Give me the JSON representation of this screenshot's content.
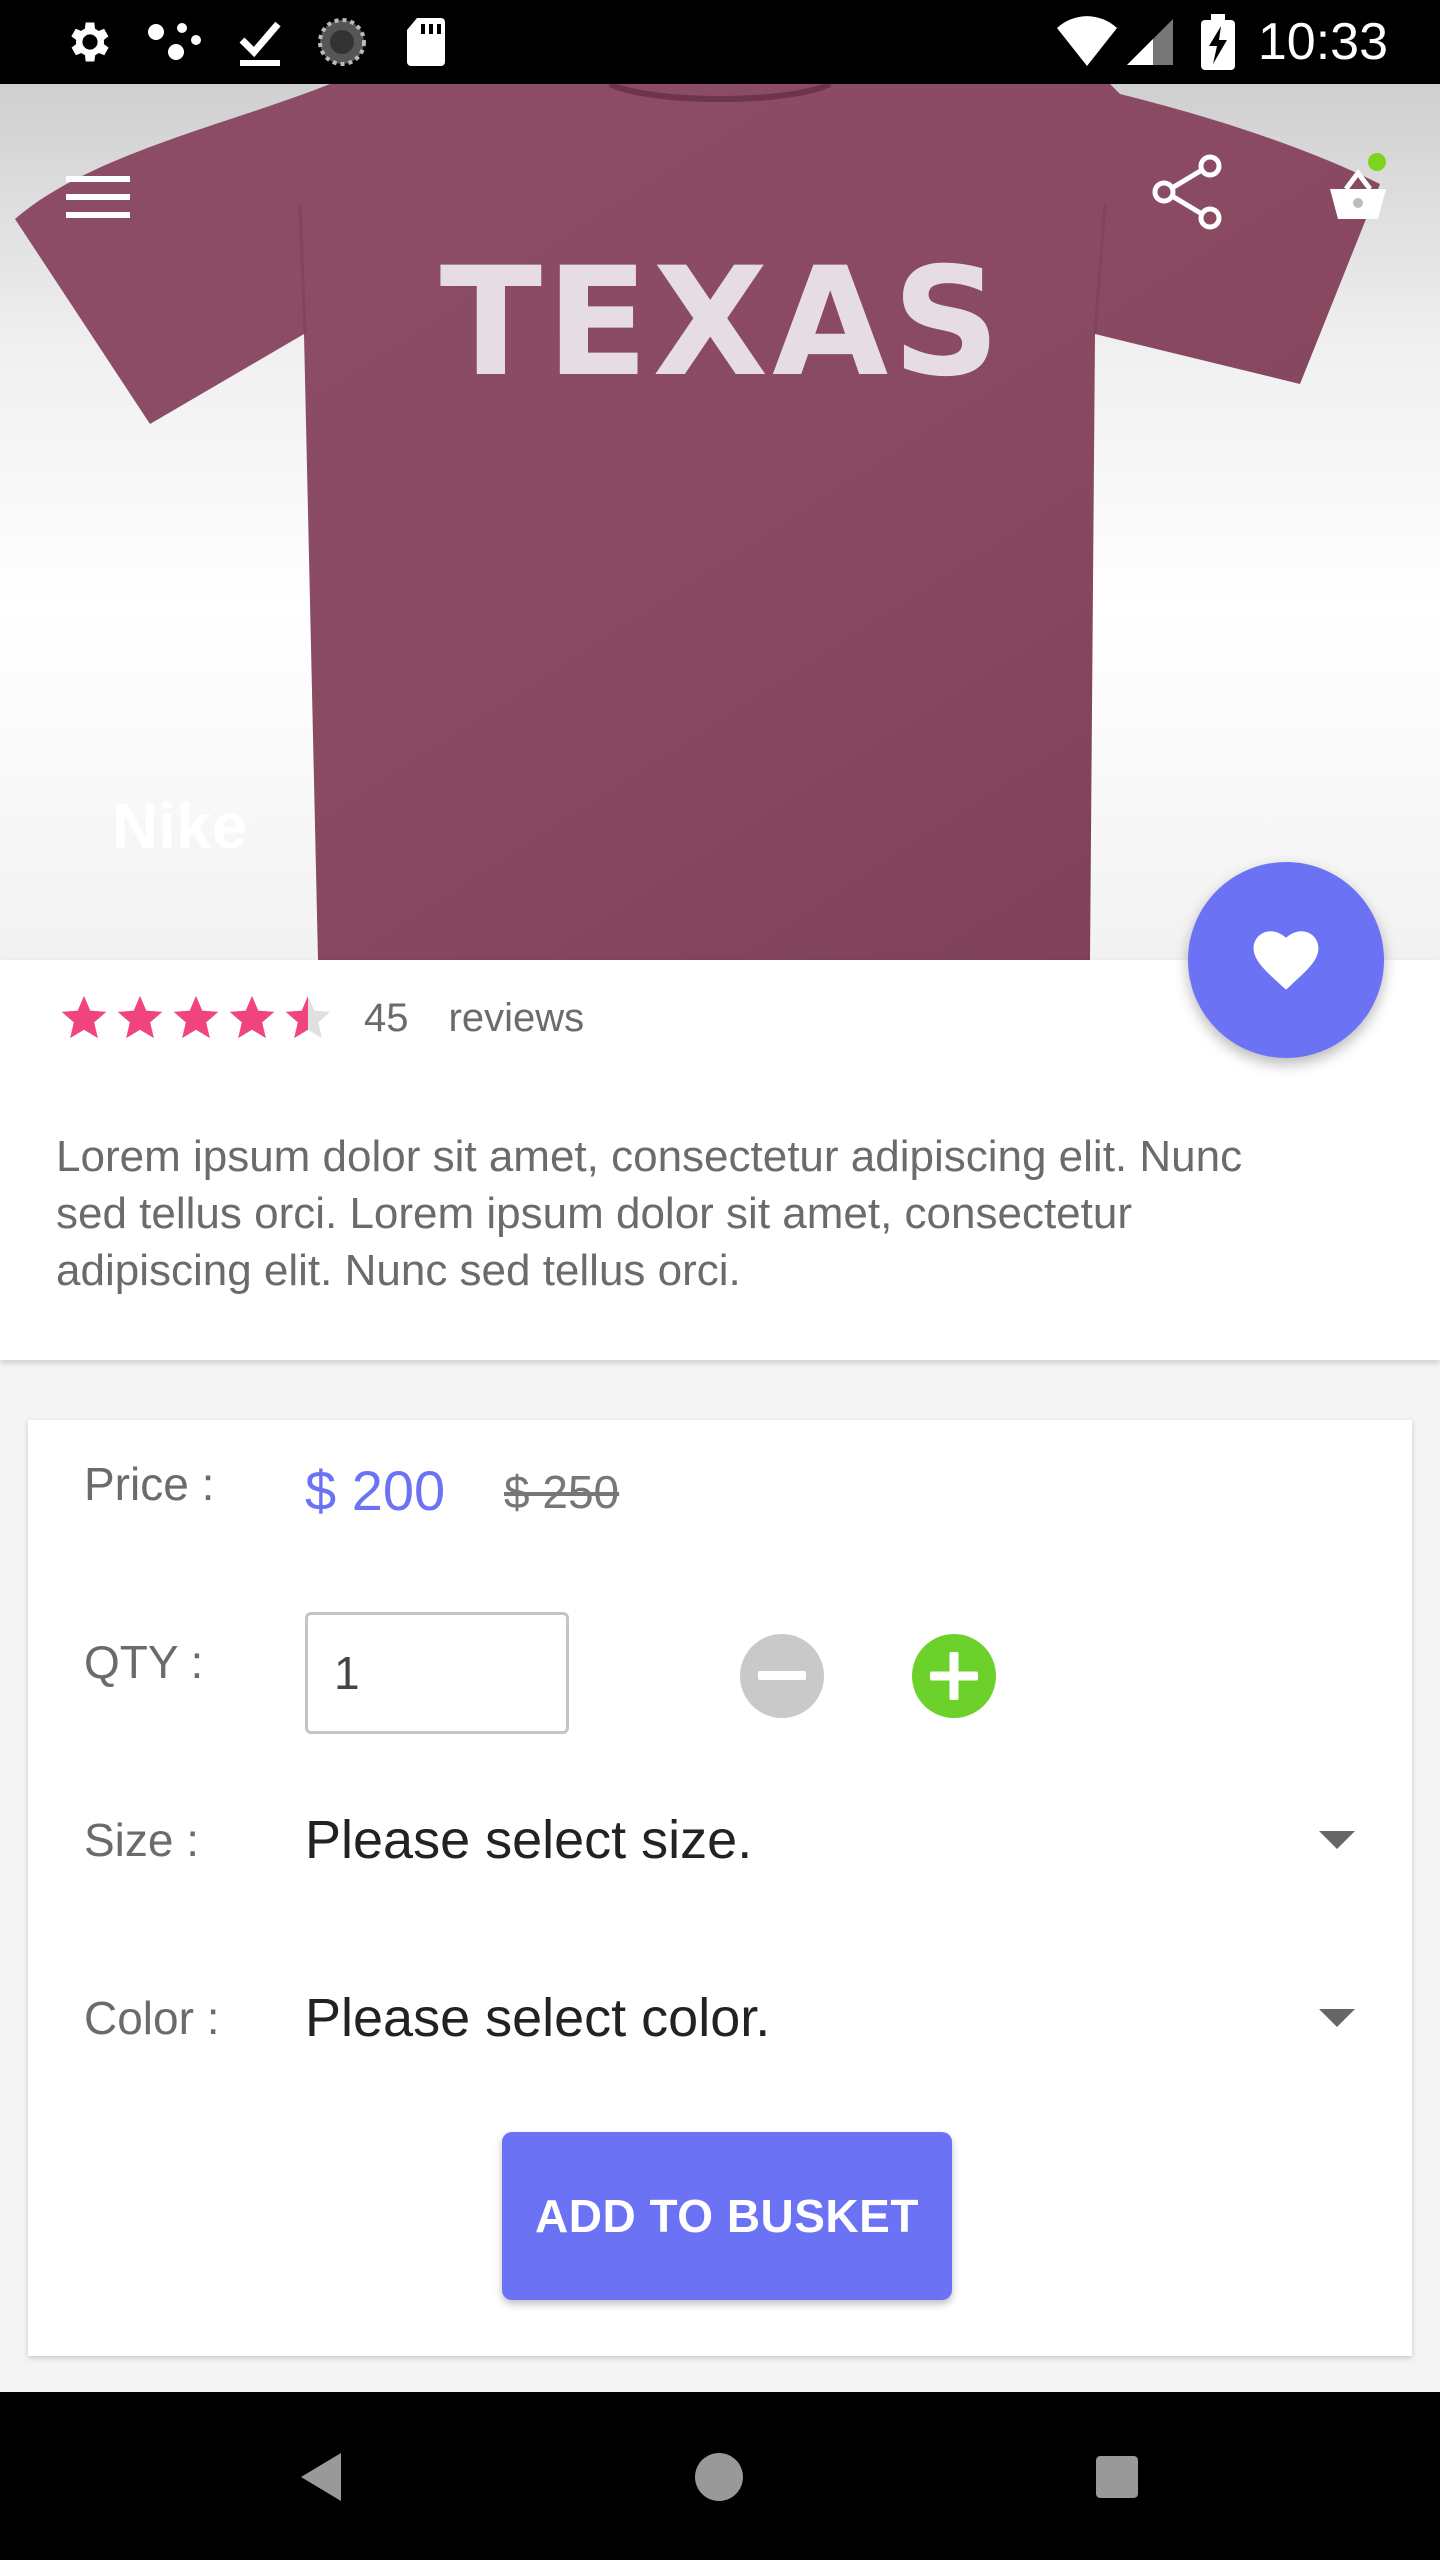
{
  "status_bar": {
    "time": "10:33",
    "icons": [
      "settings-icon",
      "connections-icon",
      "download-done-icon",
      "progress-icon",
      "sd-card-icon",
      "wifi-icon",
      "cellular-signal-icon",
      "battery-charging-icon"
    ]
  },
  "hero": {
    "shirt_text": "TEXAS",
    "shirt_color": "#8a4a63",
    "brand": "Nike",
    "icons": [
      "menu-icon",
      "share-icon",
      "cart-icon"
    ],
    "cart_badge_color": "#7ed321"
  },
  "product": {
    "rating_stars": 4.5,
    "rating_max": 5,
    "review_count": "45",
    "reviews_label": "reviews",
    "description": "Lorem ipsum dolor sit amet, consectetur adipiscing elit. Nunc sed tellus orci. Lorem ipsum dolor sit amet, consectetur adipiscing elit. Nunc sed tellus orci.",
    "star_color": "#f0447f"
  },
  "fab": {
    "icon": "heart-icon",
    "color": "#6b72f3"
  },
  "order": {
    "price_label": "Price :",
    "price_current": "$ 200",
    "price_original": "$ 250",
    "qty_label": "QTY :",
    "qty_value": "1",
    "size_label": "Size :",
    "size_placeholder": "Please select size.",
    "color_label": "Color :",
    "color_placeholder": "Please select color.",
    "add_button": "ADD TO BUSKET",
    "accent_color": "#6b72f3",
    "plus_color": "#6cd12b",
    "minus_color": "#c9c9c9"
  },
  "nav_bar": {
    "icons": [
      "back-icon",
      "home-icon",
      "recents-icon"
    ]
  }
}
